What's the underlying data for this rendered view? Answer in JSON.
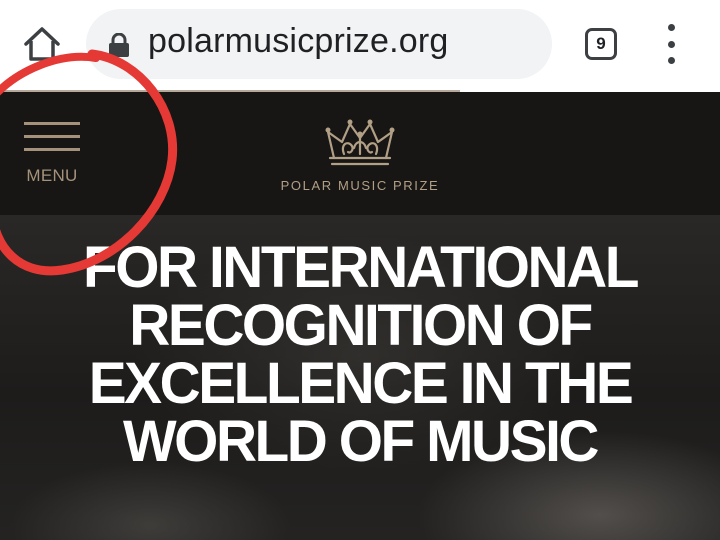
{
  "browser": {
    "url": "polarmusicprize.org",
    "tab_count": "9",
    "icons": {
      "home": "home-icon",
      "lock": "lock-icon",
      "menu": "more-vert-icon"
    }
  },
  "site": {
    "menu_label": "MENU",
    "brand_name": "POLAR MUSIC PRIZE",
    "colors": {
      "header_bg": "#181614",
      "accent_gold": "#a4927a"
    }
  },
  "hero": {
    "lines": [
      "FOR INTERNATIONAL",
      "RECOGNITION OF",
      "EXCELLENCE IN THE",
      "WORLD OF MUSIC"
    ]
  },
  "annotation": {
    "color": "#e53935",
    "shape": "circle"
  }
}
